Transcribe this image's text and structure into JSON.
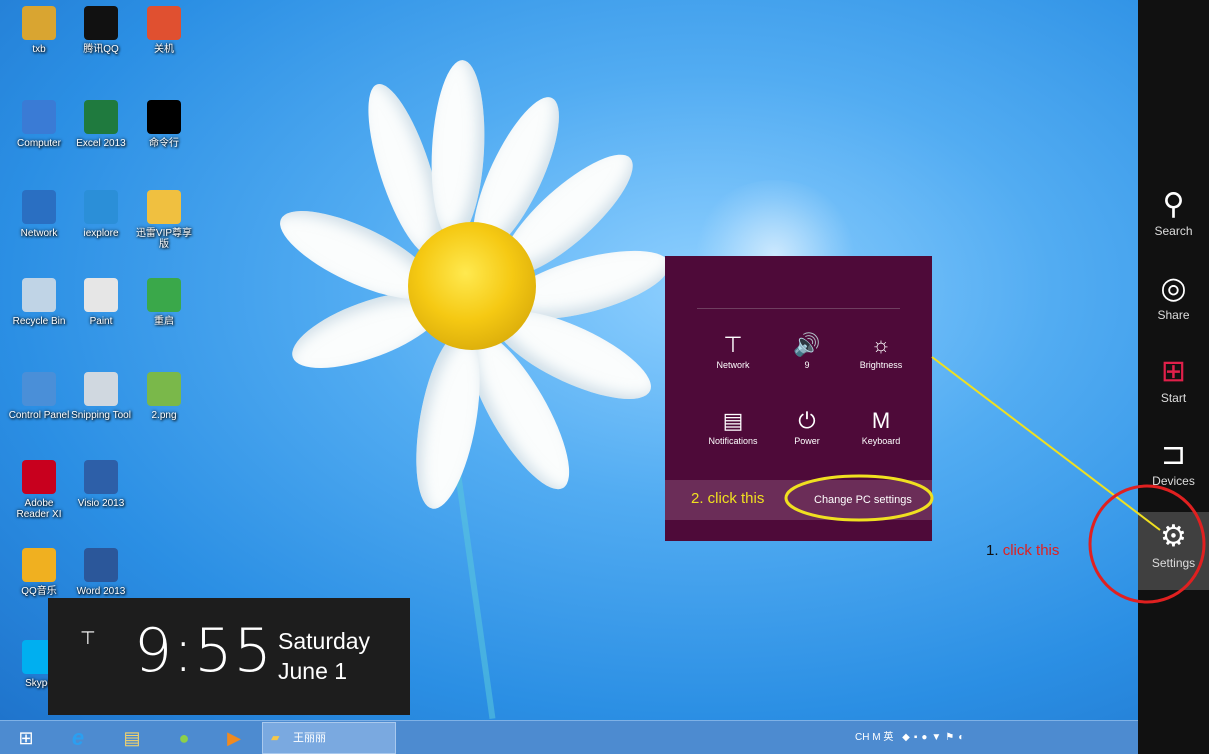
{
  "desktop": {
    "icons": [
      {
        "label": "txb",
        "icon": "folder-user-icon",
        "color": "#d9a531"
      },
      {
        "label": "腾讯QQ",
        "icon": "qq-penguin-icon",
        "color": "#111111"
      },
      {
        "label": "关机",
        "icon": "shutdown-icon",
        "color": "#e05030"
      },
      {
        "label": "Computer",
        "icon": "computer-icon",
        "color": "#3a7bd5"
      },
      {
        "label": "Excel 2013",
        "icon": "excel-icon",
        "color": "#1f7a3e"
      },
      {
        "label": "命令行",
        "icon": "terminal-icon",
        "color": "#000000"
      },
      {
        "label": "Network",
        "icon": "network-globe-icon",
        "color": "#2a6fc2"
      },
      {
        "label": "iexplore",
        "icon": "internet-explorer-icon",
        "color": "#2b8fd8"
      },
      {
        "label": "迅雷VIP尊享版",
        "icon": "thunder-bird-icon",
        "color": "#f0c040"
      },
      {
        "label": "Recycle Bin",
        "icon": "recycle-bin-icon",
        "color": "#c0d4e6"
      },
      {
        "label": "Paint",
        "icon": "paint-icon",
        "color": "#e6e6e6"
      },
      {
        "label": "重启",
        "icon": "restart-icon",
        "color": "#3aa84a"
      },
      {
        "label": "Control Panel",
        "icon": "control-panel-icon",
        "color": "#4a8fd8"
      },
      {
        "label": "Snipping Tool",
        "icon": "scissors-icon",
        "color": "#d0d8e0"
      },
      {
        "label": "2.png",
        "icon": "image-file-icon",
        "color": "#7ab84a"
      },
      {
        "label": "Adobe Reader XI",
        "icon": "adobe-reader-icon",
        "color": "#c8001e"
      },
      {
        "label": "Visio 2013",
        "icon": "visio-icon",
        "color": "#2d5fa8"
      },
      {
        "label": "QQ音乐",
        "icon": "qq-music-icon",
        "color": "#f0b020"
      },
      {
        "label": "Word 2013",
        "icon": "word-icon",
        "color": "#2b579a"
      },
      {
        "label": "Skype",
        "icon": "skype-icon",
        "color": "#00aff0"
      }
    ]
  },
  "charms": [
    {
      "label": "Search",
      "icon": "search-icon",
      "glyph": "⚲"
    },
    {
      "label": "Share",
      "icon": "share-icon",
      "glyph": "◎"
    },
    {
      "label": "Start",
      "icon": "windows-logo-icon",
      "glyph": "⊞"
    },
    {
      "label": "Devices",
      "icon": "devices-icon",
      "glyph": "⊐"
    },
    {
      "label": "Settings",
      "icon": "gear-icon",
      "glyph": "⚙"
    }
  ],
  "settings_panel": {
    "quick_settings": [
      {
        "label": "Network",
        "icon": "network-icon",
        "glyph": "⊤"
      },
      {
        "label": "9",
        "icon": "volume-icon",
        "glyph": "🔊"
      },
      {
        "label": "Brightness",
        "icon": "brightness-icon",
        "glyph": "☼"
      },
      {
        "label": "Notifications",
        "icon": "notifications-icon",
        "glyph": "▤"
      },
      {
        "label": "Power",
        "icon": "power-icon",
        "glyph": "⏻"
      },
      {
        "label": "Keyboard",
        "icon": "keyboard-icon",
        "glyph": "M"
      }
    ],
    "change_pc_settings": "Change PC settings"
  },
  "annotations": {
    "step1": {
      "number": "1.",
      "text": "click this"
    },
    "step2": "2. click this",
    "colors": {
      "highlight": "#f0e020",
      "alert": "#e02020"
    }
  },
  "clock": {
    "time": "9:55",
    "day": "Saturday",
    "date": "June 1"
  },
  "taskbar": {
    "window_label": "王丽丽",
    "tray_text": "CH M 英"
  }
}
